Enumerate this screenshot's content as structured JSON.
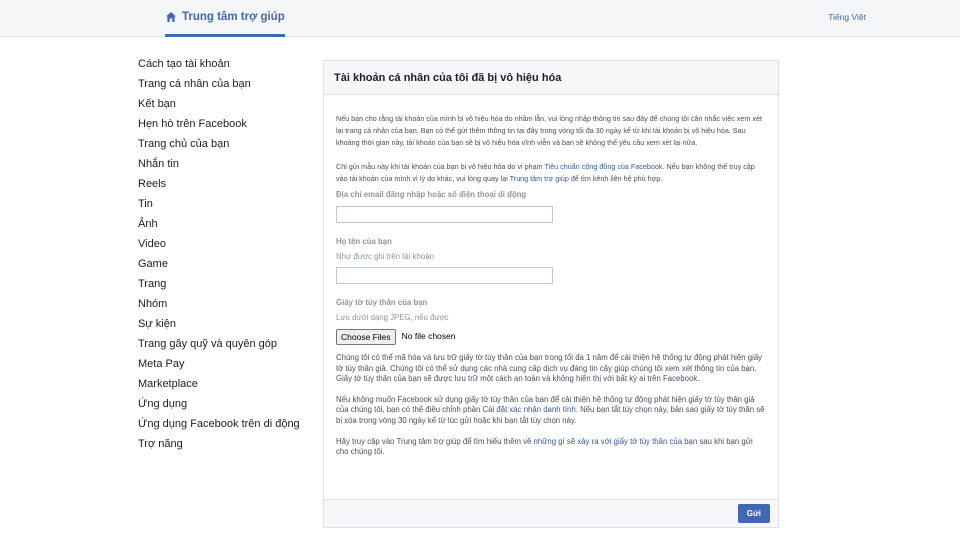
{
  "header": {
    "title": "Trung tâm trợ giúp",
    "language": "Tiếng Việt"
  },
  "sidebar": {
    "items": [
      "Cách tạo tài khoản",
      "Trang cá nhân của bạn",
      "Kết bạn",
      "Hẹn hò trên Facebook",
      "Trang chủ của bạn",
      "Nhắn tin",
      "Reels",
      "Tin",
      "Ảnh",
      "Video",
      "Game",
      "Trang",
      "Nhóm",
      "Sự kiện",
      "Trang gây quỹ và quyên góp",
      "Meta Pay",
      "Marketplace",
      "Ứng dụng",
      "Ứng dụng Facebook trên di động",
      "Trợ năng"
    ]
  },
  "form": {
    "title": "Tài khoản cá nhân của tôi đã bị vô hiệu hóa",
    "intro": "Nếu bạn cho rằng tài khoản của mình bị vô hiệu hóa do nhầm lẫn, vui lòng nhập thông tin sau đây để chúng tôi cân nhắc việc xem xét lại trang cá nhân của bạn. Bạn có thể gửi thêm thông tin tại đây trong vòng tối đa 30 ngày kể từ khi tài khoản bị vô hiệu hóa. Sau khoảng thời gian này, tài khoản của bạn sẽ bị vô hiệu hóa vĩnh viễn và bạn sẽ không thể yêu cầu xem xét lại nữa.",
    "notice_part1": "Chỉ gửi mẫu này khi tài khoản của bạn bị vô hiệu hóa do vi phạm ",
    "notice_link1": "Tiêu chuẩn cộng đồng của Facebook",
    "notice_part2": ". Nếu bạn không thể truy cập vào tài khoản của mình vì lý do khác, vui lòng quay lại ",
    "notice_link2": "Trung tâm trợ giúp",
    "notice_part3": " để tìm kênh liên hệ phù hợp.",
    "email_label": "Địa chỉ email đăng nhập hoặc số điện thoại di động",
    "email_value": "",
    "name_label": "Họ tên của bạn",
    "name_hint": "Như được ghi trên tài khoản",
    "name_value": "",
    "id_label": "Giấy tờ tùy thân của bạn",
    "id_hint": "Lưu dưới dạng JPEG, nếu được",
    "file_button": "Choose Files",
    "file_status": "No file chosen",
    "storage_text": "Chúng tôi có thể mã hóa và lưu trữ giấy tờ tùy thân của bạn trong tối đa 1 năm để cải thiện hệ thống tự động phát hiện giấy tờ tùy thân giả. Chúng tôi có thể sử dụng các nhà cung cấp dịch vụ đáng tin cậy giúp chúng tôi xem xét thông tin của bạn. Giấy tờ tùy thân của bạn sẽ được lưu trữ một cách an toàn và không hiển thị với bất kỳ ai trên Facebook.",
    "optout_part1": "Nếu không muốn Facebook sử dụng giấy tờ tùy thân của bạn để cải thiện hệ thống tự động phát hiện giấy tờ tùy thân giả của chúng tôi, bạn có thể điều chỉnh phần ",
    "optout_link": "Cài đặt xác nhận danh tính",
    "optout_part2": ". Nếu bạn tắt tùy chọn này, bản sao giấy tờ tùy thân sẽ bị xóa trong vòng 30 ngày kể từ lúc gửi hoặc khi bạn tắt tùy chọn này.",
    "learn_part1": "Hãy truy cập vào Trung tâm trợ giúp để tìm hiểu thêm về ",
    "learn_link": "những gì sẽ xảy ra với giấy tờ tùy thân của bạn",
    "learn_part2": " sau khi bạn gửi cho chúng tôi.",
    "submit_label": "Gửi"
  }
}
